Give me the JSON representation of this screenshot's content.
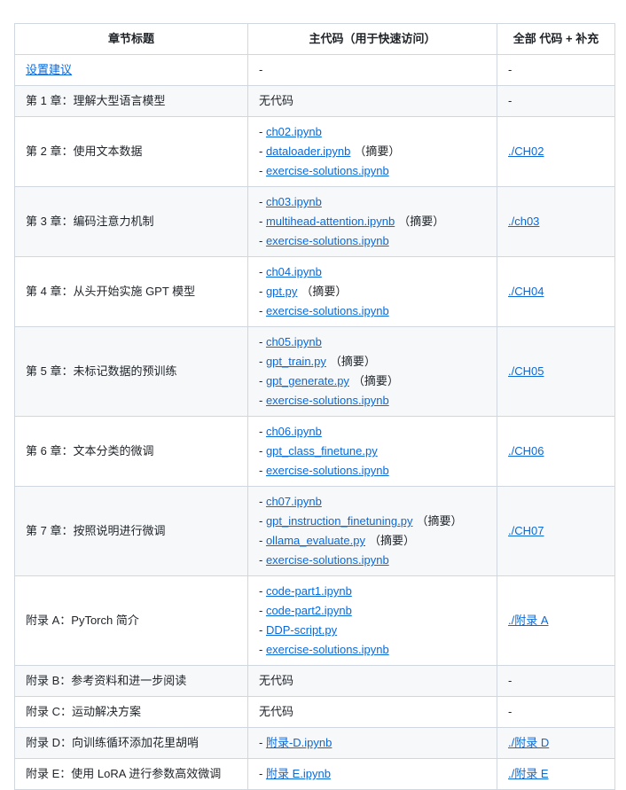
{
  "headers": [
    "章节标题",
    "主代码（用于快速访问）",
    "全部 代码 + 补充"
  ],
  "rows": [
    {
      "title": "设置建议",
      "title_link": true,
      "main": [
        {
          "text": "-"
        }
      ],
      "all": "-",
      "all_link": false
    },
    {
      "title": "第 1 章：理解大型语言模型",
      "main": [
        {
          "text": "无代码"
        }
      ],
      "all": "-",
      "all_link": false
    },
    {
      "title": "第 2 章：使用文本数据",
      "main": [
        {
          "link": "ch02.ipynb"
        },
        {
          "link": "dataloader.ipynb",
          "note": "（摘要）"
        },
        {
          "link": "exercise-solutions.ipynb"
        }
      ],
      "all": "./CH02",
      "all_link": true
    },
    {
      "title": "第 3 章：编码注意力机制",
      "main": [
        {
          "link": "ch03.ipynb"
        },
        {
          "link": "multihead-attention.ipynb",
          "note": "（摘要）"
        },
        {
          "link": "exercise-solutions.ipynb"
        }
      ],
      "all": "./ch03",
      "all_link": true
    },
    {
      "title": "第 4 章：从头开始实施 GPT 模型",
      "main": [
        {
          "link": "ch04.ipynb"
        },
        {
          "link": "gpt.py",
          "note": "（摘要）"
        },
        {
          "link": "exercise-solutions.ipynb"
        }
      ],
      "all": "./CH04",
      "all_link": true
    },
    {
      "title": "第 5 章：未标记数据的预训练",
      "main": [
        {
          "link": "ch05.ipynb"
        },
        {
          "link": "gpt_train.py",
          "note": "（摘要）"
        },
        {
          "link": "gpt_generate.py",
          "note": "（摘要）"
        },
        {
          "link": "exercise-solutions.ipynb"
        }
      ],
      "all": "./CH05",
      "all_link": true
    },
    {
      "title": "第 6 章：文本分类的微调",
      "main": [
        {
          "link": "ch06.ipynb"
        },
        {
          "link": "gpt_class_finetune.py"
        },
        {
          "link": "exercise-solutions.ipynb"
        }
      ],
      "all": "./CH06",
      "all_link": true
    },
    {
      "title": "第 7 章：按照说明进行微调",
      "main": [
        {
          "link": "ch07.ipynb"
        },
        {
          "link": "gpt_instruction_finetuning.py",
          "note": "（摘要）"
        },
        {
          "link": "ollama_evaluate.py",
          "note": "（摘要）"
        },
        {
          "link": "exercise-solutions.ipynb"
        }
      ],
      "all": "./CH07",
      "all_link": true
    },
    {
      "title": "附录 A：PyTorch 简介",
      "main": [
        {
          "link": "code-part1.ipynb"
        },
        {
          "link": "code-part2.ipynb"
        },
        {
          "link": "DDP-script.py"
        },
        {
          "link": "exercise-solutions.ipynb"
        }
      ],
      "all": "./附录 A",
      "all_link": true
    },
    {
      "title": "附录 B：参考资料和进一步阅读",
      "main": [
        {
          "text": "无代码"
        }
      ],
      "all": "-",
      "all_link": false
    },
    {
      "title": "附录 C：运动解决方案",
      "main": [
        {
          "text": "无代码"
        }
      ],
      "all": "-",
      "all_link": false
    },
    {
      "title": "附录 D：向训练循环添加花里胡哨",
      "main": [
        {
          "link": "附录-D.ipynb"
        }
      ],
      "all": "./附录 D",
      "all_link": true
    },
    {
      "title": "附录 E：使用 LoRA 进行参数高效微调",
      "main": [
        {
          "link": "附录 E.ipynb"
        }
      ],
      "all": "./附录 E",
      "all_link": true
    }
  ]
}
